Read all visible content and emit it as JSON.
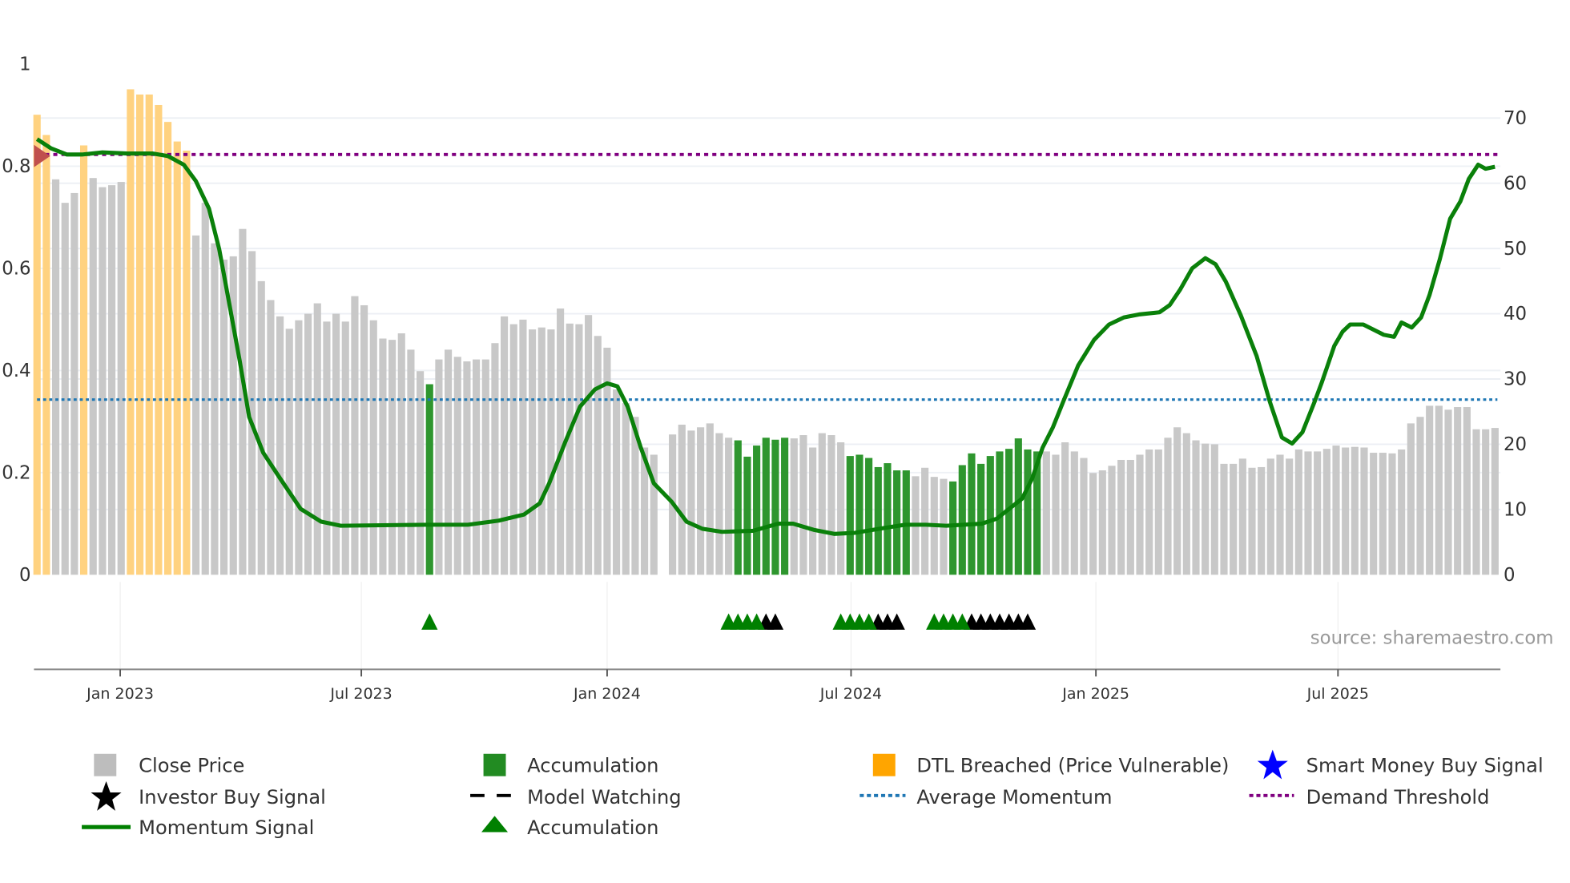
{
  "chart_data": {
    "type": "bar",
    "title": "",
    "left_axis": {
      "ticks": [
        "0",
        "0.2",
        "0.4",
        "0.6",
        "0.8",
        "1"
      ],
      "range": [
        0,
        1
      ]
    },
    "right_axis": {
      "ticks": [
        "0",
        "10",
        "20",
        "30",
        "40",
        "50",
        "60",
        "70"
      ],
      "range": [
        0,
        70
      ]
    },
    "x_ticks": [
      {
        "label": "Jan 2023",
        "week_index": 8.9
      },
      {
        "label": "Jul 2023",
        "week_index": 34.7
      },
      {
        "label": "Jan 2024",
        "week_index": 61.0
      },
      {
        "label": "Jul 2024",
        "week_index": 87.1
      },
      {
        "label": "Jan 2025",
        "week_index": 113.3
      },
      {
        "label": "Jul 2025",
        "week_index": 139.2
      }
    ],
    "close_price": [
      70.5,
      67.4,
      60.6,
      57,
      58.5,
      65.8,
      60.8,
      59.4,
      59.7,
      60.2,
      74.4,
      73.6,
      73.6,
      72,
      69.4,
      66.4,
      65,
      52,
      57,
      50.8,
      48.3,
      48.8,
      53,
      49.6,
      45,
      42.1,
      39.6,
      37.7,
      39,
      40,
      41.6,
      38.8,
      40,
      38.8,
      42.7,
      41.3,
      39,
      36.2,
      36,
      37,
      34.5,
      31.2,
      29.2,
      33,
      34.5,
      33.4,
      32.7,
      33,
      33,
      35.5,
      39.6,
      38.4,
      39.1,
      37.6,
      37.9,
      37.6,
      40.8,
      38.5,
      38.4,
      39.8,
      36.6,
      34.8,
      28.4,
      26.3,
      24.2,
      19.5,
      18.4,
      null,
      21.5,
      23,
      22.1,
      22.6,
      23.2,
      21.7,
      21,
      20.6,
      18.1,
      19.8,
      21,
      20.7,
      21,
      20.9,
      21.4,
      19.5,
      21.7,
      21.4,
      20.3,
      18.2,
      18.4,
      17.9,
      16.5,
      17.1,
      16,
      16,
      15.1,
      16.4,
      15,
      14.7,
      14.3,
      16.8,
      18.6,
      17,
      18.2,
      18.9,
      19.3,
      20.9,
      19.2,
      18.9,
      18.9,
      18.4,
      20.3,
      18.9,
      17.9,
      15.6,
      16,
      16.7,
      17.6,
      17.6,
      18.4,
      19.2,
      19.2,
      21,
      22.6,
      21.7,
      20.6,
      20.1,
      20,
      17,
      17,
      17.8,
      16.4,
      16.5,
      17.8,
      18.4,
      17.8,
      19.2,
      18.9,
      18.9,
      19.3,
      19.8,
      19.5,
      19.6,
      19.5,
      18.7,
      18.7,
      18.6,
      19.2,
      23.2,
      24.2,
      25.9,
      25.9,
      25.3,
      25.7,
      25.7,
      22.3,
      22.3,
      22.5
    ],
    "dtl_breached_weeks": [
      0,
      1,
      5,
      10,
      11,
      12,
      13,
      14,
      15,
      16
    ],
    "accumulation_weeks": [
      42,
      75,
      76,
      77,
      78,
      79,
      80,
      87,
      88,
      89,
      90,
      91,
      92,
      93,
      98,
      99,
      100,
      101,
      102,
      103,
      104,
      105,
      106,
      107
    ],
    "momentum_signal": [
      [
        0,
        0.853
      ],
      [
        1.5,
        0.835
      ],
      [
        3.2,
        0.823
      ],
      [
        4.8,
        0.823
      ],
      [
        7,
        0.827
      ],
      [
        9.7,
        0.825
      ],
      [
        12.4,
        0.825
      ],
      [
        14,
        0.82
      ],
      [
        15.7,
        0.803
      ],
      [
        17,
        0.771
      ],
      [
        18.4,
        0.717
      ],
      [
        19.5,
        0.637
      ],
      [
        20.6,
        0.528
      ],
      [
        21.7,
        0.418
      ],
      [
        22.7,
        0.309
      ],
      [
        24.2,
        0.239
      ],
      [
        26,
        0.189
      ],
      [
        28.2,
        0.129
      ],
      [
        30.4,
        0.104
      ],
      [
        32.5,
        0.096
      ],
      [
        41.8,
        0.098
      ],
      [
        46.1,
        0.098
      ],
      [
        49.4,
        0.106
      ],
      [
        52.1,
        0.118
      ],
      [
        53.8,
        0.14
      ],
      [
        54.8,
        0.179
      ],
      [
        56.5,
        0.259
      ],
      [
        58.1,
        0.329
      ],
      [
        59.7,
        0.363
      ],
      [
        61,
        0.375
      ],
      [
        62.1,
        0.369
      ],
      [
        63.2,
        0.329
      ],
      [
        64.6,
        0.249
      ],
      [
        66,
        0.179
      ],
      [
        67.9,
        0.143
      ],
      [
        69.5,
        0.104
      ],
      [
        71.2,
        0.09
      ],
      [
        73.3,
        0.084
      ],
      [
        76.6,
        0.086
      ],
      [
        79.3,
        0.1
      ],
      [
        80.9,
        0.1
      ],
      [
        83.1,
        0.088
      ],
      [
        85.3,
        0.08
      ],
      [
        87.5,
        0.082
      ],
      [
        90.8,
        0.092
      ],
      [
        92.9,
        0.098
      ],
      [
        95.1,
        0.098
      ],
      [
        97.3,
        0.096
      ],
      [
        101.1,
        0.1
      ],
      [
        102.7,
        0.11
      ],
      [
        105.4,
        0.149
      ],
      [
        106.5,
        0.189
      ],
      [
        107.6,
        0.249
      ],
      [
        108.7,
        0.289
      ],
      [
        109.8,
        0.339
      ],
      [
        111.4,
        0.41
      ],
      [
        113.1,
        0.46
      ],
      [
        114.7,
        0.49
      ],
      [
        116.3,
        0.504
      ],
      [
        118,
        0.51
      ],
      [
        120.1,
        0.514
      ],
      [
        121.2,
        0.528
      ],
      [
        122.3,
        0.558
      ],
      [
        123.6,
        0.6
      ],
      [
        125,
        0.62
      ],
      [
        126.1,
        0.608
      ],
      [
        127.2,
        0.574
      ],
      [
        128.8,
        0.508
      ],
      [
        130.5,
        0.428
      ],
      [
        131.9,
        0.339
      ],
      [
        133.2,
        0.269
      ],
      [
        134.3,
        0.257
      ],
      [
        135.4,
        0.279
      ],
      [
        136.7,
        0.339
      ],
      [
        137.5,
        0.378
      ],
      [
        138.8,
        0.448
      ],
      [
        139.7,
        0.476
      ],
      [
        140.5,
        0.49
      ],
      [
        141.9,
        0.49
      ],
      [
        144.1,
        0.47
      ],
      [
        145.2,
        0.466
      ],
      [
        146,
        0.494
      ],
      [
        147.1,
        0.484
      ],
      [
        148.1,
        0.504
      ],
      [
        149,
        0.548
      ],
      [
        150.1,
        0.618
      ],
      [
        151.2,
        0.697
      ],
      [
        152.3,
        0.731
      ],
      [
        153.2,
        0.775
      ],
      [
        154.2,
        0.803
      ],
      [
        155,
        0.795
      ],
      [
        156,
        0.799
      ]
    ],
    "average_momentum": 0.343,
    "demand_threshold": 0.823,
    "smart_money_marker": {
      "week_index": 0,
      "value": 0.82
    },
    "accumulation_triangles": [
      42,
      74,
      75,
      76,
      77,
      86,
      87,
      88,
      89,
      96,
      97,
      98,
      99
    ],
    "investor_buy_triangles": [
      78,
      79,
      90,
      91,
      92,
      100,
      101,
      102,
      103,
      104,
      105,
      106
    ],
    "source": "source: sharemaestro.com",
    "legend": [
      {
        "label": "Close Price",
        "symbol": "square",
        "color": "#bdbdbd"
      },
      {
        "label": "Accumulation",
        "symbol": "square",
        "color": "#228b22"
      },
      {
        "label": "DTL Breached (Price Vulnerable)",
        "symbol": "square",
        "color": "#ffa500"
      },
      {
        "label": "Smart Money Buy Signal",
        "symbol": "star",
        "color": "#0000ff"
      },
      {
        "label": "Investor Buy Signal",
        "symbol": "star",
        "color": "#000000"
      },
      {
        "label": "Model Watching",
        "symbol": "dash",
        "color": "#000000"
      },
      {
        "label": "Average Momentum",
        "symbol": "dot",
        "color": "#1f77b4"
      },
      {
        "label": "Demand Threshold",
        "symbol": "dot",
        "color": "#800080"
      },
      {
        "label": "Momentum Signal",
        "symbol": "line",
        "color": "#008000"
      },
      {
        "label": "Accumulation",
        "symbol": "triangle",
        "color": "#008000"
      }
    ],
    "colors": {
      "grey": "#c8c8c8",
      "orange": "#ffd280",
      "green": "#2e962e",
      "momentum": "#0a800a",
      "avg": "#1f77b4",
      "demand": "#800080"
    }
  }
}
